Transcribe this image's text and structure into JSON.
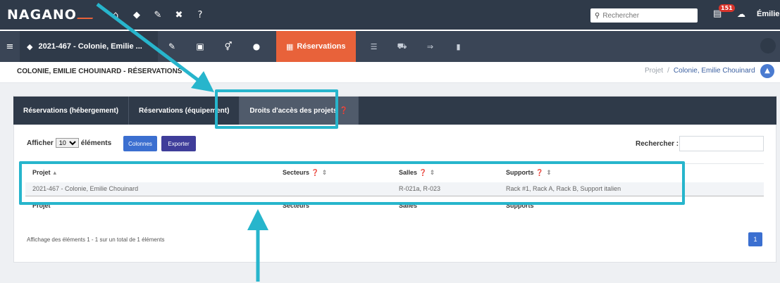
{
  "app": {
    "logo": "NAGANO"
  },
  "top_search": {
    "placeholder": "Rechercher"
  },
  "notifications": {
    "count": "151"
  },
  "user": {
    "name": "Émilie"
  },
  "project_selector": {
    "label": "2021-467 - Colonie, Emilie ..."
  },
  "reservations_tab": {
    "label": "Réservations"
  },
  "page": {
    "title": "COLONIE, EMILIE CHOUINARD - RÉSERVATIONS",
    "breadcrumb": {
      "root": "Projet",
      "separator": "/",
      "current": "Colonie, Emilie Chouinard"
    }
  },
  "tabs": [
    {
      "label": "Réservations (hébergement)"
    },
    {
      "label": "Réservations (équipement)"
    },
    {
      "label": "Droits d'accès des projets"
    }
  ],
  "table_controls": {
    "show_prefix": "Afficher",
    "show_value": "10",
    "show_suffix": "éléments",
    "columns_button": "Colonnes",
    "export_button": "Exporter",
    "search_label": "Rechercher :"
  },
  "table": {
    "headers": [
      "Projet",
      "Secteurs",
      "Salles",
      "Supports"
    ],
    "rows": [
      [
        "2021-467 - Colonie, Emilie Chouinard",
        "",
        "R-021a, R-023",
        "Rack #1, Rack A, Rack B, Support italien"
      ]
    ],
    "footer": [
      "Projet",
      "Secteurs",
      "Salles",
      "Supports"
    ]
  },
  "pagination": {
    "info": "Affichage des éléments 1 - 1 sur un total de 1 éléments",
    "current_page": "1"
  },
  "colors": {
    "topbar": "#2f3a49",
    "accent_orange": "#e8623a",
    "annotation": "#27b5cc",
    "primary_button": "#3b6fd0"
  }
}
